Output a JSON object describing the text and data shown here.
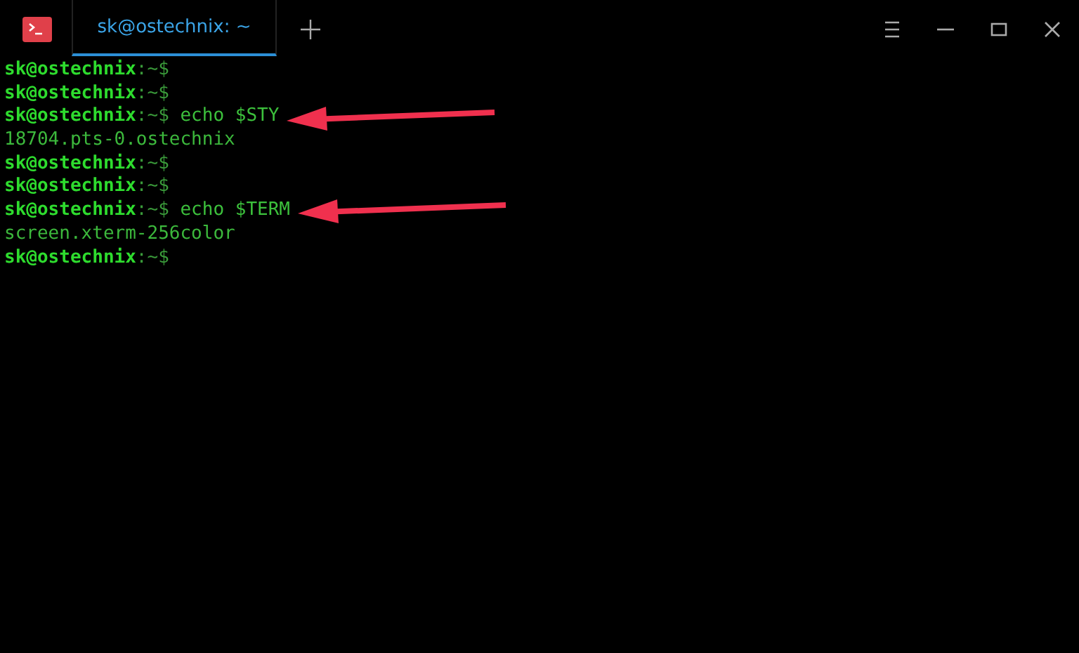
{
  "window": {
    "tabs": [
      {
        "label": "sk@ostechnix: ~",
        "selected": true
      }
    ]
  },
  "terminal": {
    "lines": [
      {
        "kind": "prompt",
        "prompt": "sk@ostechnix",
        "path": ":~$",
        "annotated": false
      },
      {
        "kind": "prompt",
        "prompt": "sk@ostechnix",
        "path": ":~$",
        "annotated": false
      },
      {
        "kind": "prompt",
        "prompt": "sk@ostechnix",
        "path": ":~$",
        "command": "echo $STY",
        "annotated": true
      },
      {
        "kind": "output",
        "text": "18704.pts-0.ostechnix"
      },
      {
        "kind": "prompt",
        "prompt": "sk@ostechnix",
        "path": ":~$",
        "annotated": false
      },
      {
        "kind": "prompt",
        "prompt": "sk@ostechnix",
        "path": ":~$",
        "annotated": false
      },
      {
        "kind": "prompt",
        "prompt": "sk@ostechnix",
        "path": ":~$",
        "command": "echo $TERM",
        "annotated": true
      },
      {
        "kind": "output",
        "text": "screen.xterm-256color"
      },
      {
        "kind": "prompt",
        "prompt": "sk@ostechnix",
        "path": ":~$",
        "annotated": false
      }
    ]
  }
}
